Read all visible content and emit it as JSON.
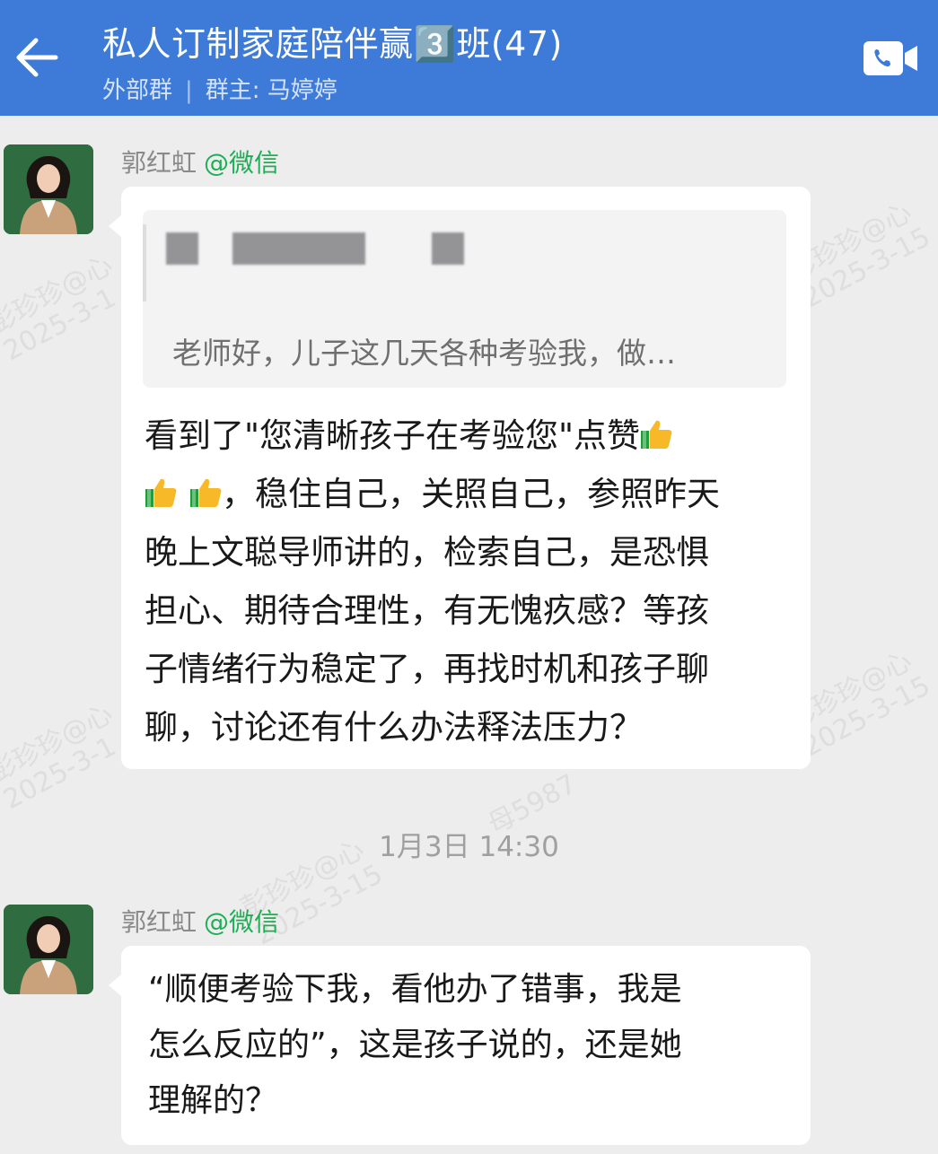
{
  "header": {
    "title": "私人订制家庭陪伴赢3️⃣班(47)",
    "group_type": "外部群",
    "group_owner": "群主: 马婷婷"
  },
  "icons": {
    "back": "arrow-left-icon",
    "video_call": "video-camera-icon",
    "reaction": "thumbs-up-emoji"
  },
  "watermarks": [
    "彭珍珍@心",
    "2025-3-1",
    "彭珍珍@心",
    "2025-3-15",
    "母5987"
  ],
  "messages": [
    {
      "sender": "郭红虹",
      "source": "@微信",
      "quote_text": "老师好，儿子这几天各种考验我，做…",
      "text_lines": [
        "看到了\"您清晰孩子在考验您\"点赞",
        "，稳住自己，关照自己，参照昨天",
        "晚上文聪导师讲的，检索自己，是恐惧",
        "担心、期待合理性，有无愧疚感？等孩",
        "子情绪行为稳定了，再找时机和孩子聊",
        "聊，讨论还有什么办法释法压力？"
      ]
    },
    {
      "sender": "郭红虹",
      "source": "@微信",
      "text_lines": [
        "“顺便考验下我，看他办了错事，我是",
        "怎么反应的”，这是孩子说的，还是她",
        "理解的？"
      ]
    }
  ],
  "timestamp": "1月3日 14:30",
  "colors": {
    "header_bg": "#3e7bd8",
    "chat_bg": "#ededed",
    "source_green": "#1fae55"
  }
}
